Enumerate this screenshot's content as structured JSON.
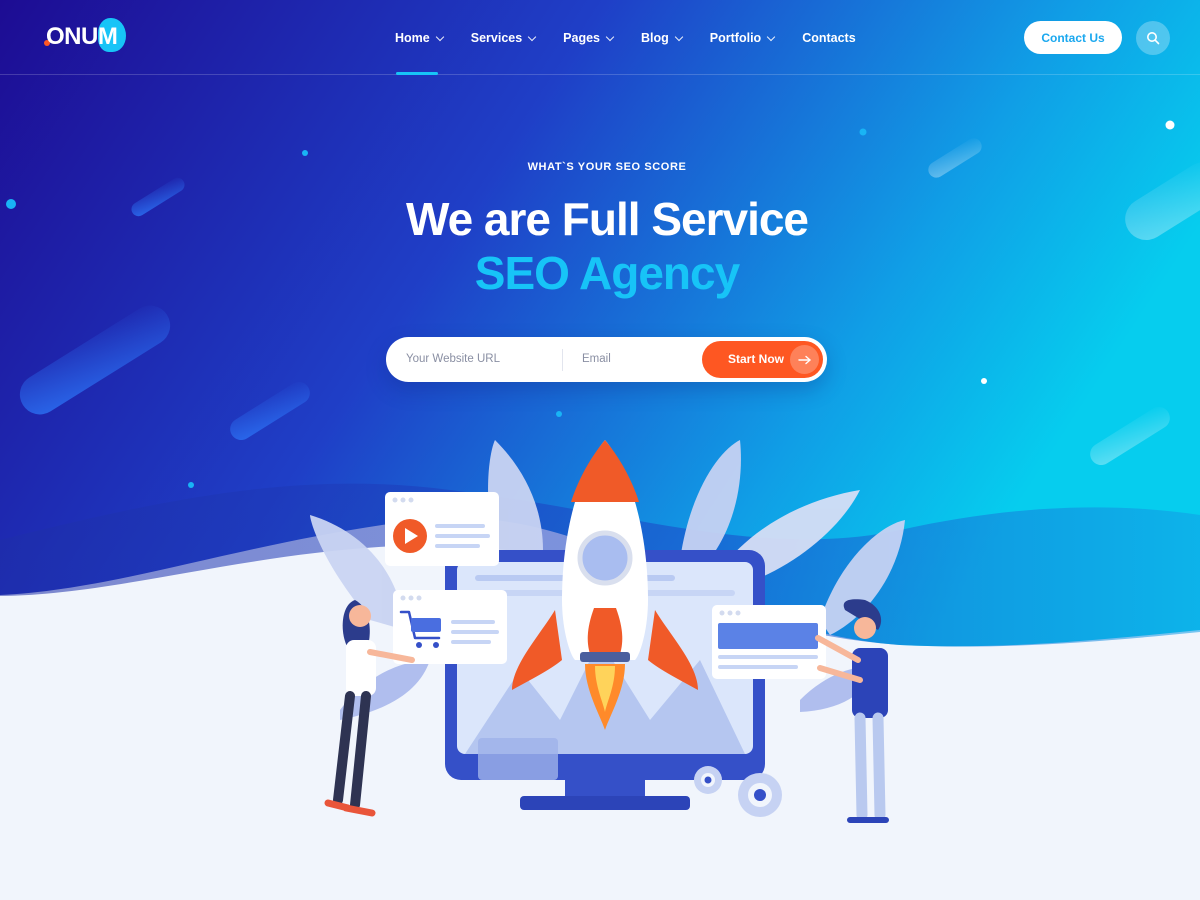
{
  "brand": {
    "name": "ONUM"
  },
  "nav": {
    "items": [
      {
        "label": "Home",
        "has_dropdown": true,
        "active": true
      },
      {
        "label": "Services",
        "has_dropdown": true,
        "active": false
      },
      {
        "label": "Pages",
        "has_dropdown": true,
        "active": false
      },
      {
        "label": "Blog",
        "has_dropdown": true,
        "active": false
      },
      {
        "label": "Portfolio",
        "has_dropdown": true,
        "active": false
      },
      {
        "label": "Contacts",
        "has_dropdown": false,
        "active": false
      }
    ],
    "contact_button": "Contact Us",
    "search_icon": "search-icon"
  },
  "hero": {
    "eyebrow": "WHAT`S YOUR SEO SCORE",
    "title_line1": "We are Full Service",
    "title_line2": "SEO Agency",
    "form": {
      "url_placeholder": "Your Website URL",
      "email_placeholder": "Email",
      "submit_label": "Start Now",
      "submit_icon": "arrow-right-icon"
    }
  },
  "colors": {
    "hero_start": "#1d0e96",
    "hero_end": "#07c6ec",
    "accent": "#17c4f7",
    "cta": "#fe5722",
    "page_bg": "#f1f5fc"
  }
}
